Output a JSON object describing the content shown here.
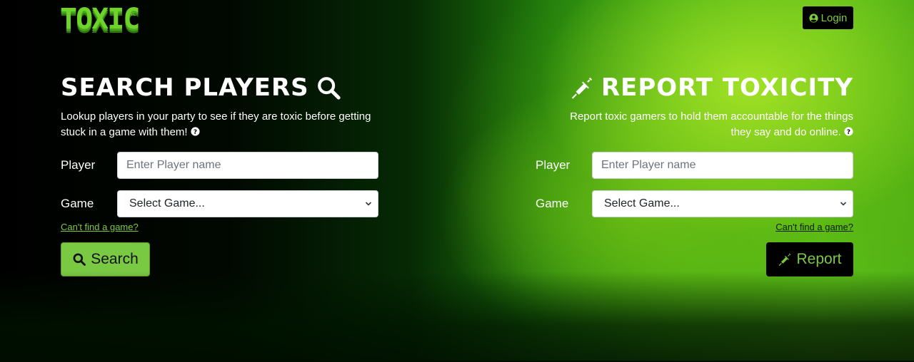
{
  "header": {
    "logo_text": "TOXIC",
    "logo_suffix": "INL",
    "login_label": "Login"
  },
  "search_section": {
    "title": "SEARCH PLAYERS",
    "description": "Lookup players in your party to see if they are toxic before getting stuck in a game with them!",
    "player_label": "Player",
    "player_placeholder": "Enter Player name",
    "game_label": "Game",
    "game_selected": "Select Game...",
    "cant_find_link": "Can't find a game?",
    "button_label": "Search"
  },
  "report_section": {
    "title": "REPORT TOXICITY",
    "description_line1": "Report toxic gamers to hold them accountable for the things",
    "description_line2": "they say and do online.",
    "player_label": "Player",
    "player_placeholder": "Enter Player name",
    "game_label": "Game",
    "game_selected": "Select Game...",
    "cant_find_link": "Can't find a game?",
    "button_label": "Report"
  },
  "colors": {
    "accent_green": "#7ac943",
    "logo_green": "#6fd42a",
    "dark": "#000000"
  }
}
